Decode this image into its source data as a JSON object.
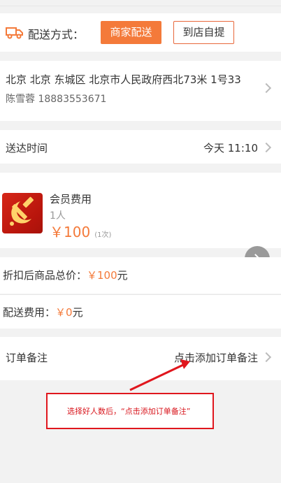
{
  "delivery": {
    "label": "配送方式：",
    "options": [
      "商家配送",
      "到店自提"
    ],
    "selected": "商家配送"
  },
  "address": {
    "line": "北京 北京 东城区 北京市人民政府西北73米 1号33",
    "contact": "陈雪蓉 18883553671"
  },
  "delivery_time": {
    "label": "送达时间",
    "value": "今天 11:10"
  },
  "product": {
    "name": "会员费用",
    "quantity": "1人",
    "price": "￥100",
    "count": "(1次)"
  },
  "totals": {
    "discount_label": "折扣后商品总价：",
    "discount_value": "￥100",
    "discount_unit": "元",
    "fee_label": "配送费用：",
    "fee_value": "￥0",
    "fee_unit": "元"
  },
  "remark": {
    "label": "订单备注",
    "link": "点击添加订单备注"
  },
  "annotation": {
    "text": "选择好人数后，“点击添加订单备注”"
  },
  "colors": {
    "accent": "#f47a3a",
    "annotation": "#e0161d"
  }
}
